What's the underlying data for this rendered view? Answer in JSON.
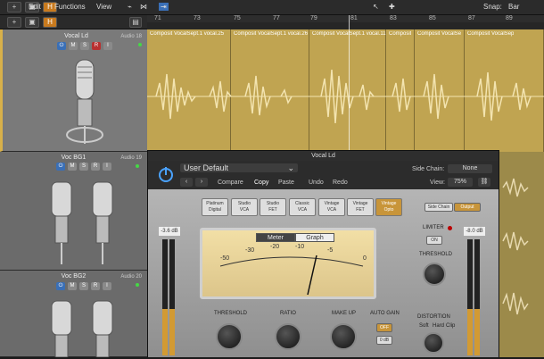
{
  "menubar": {
    "edit": "Edit",
    "functions": "Functions",
    "view": "View",
    "snap_label": "Snap:",
    "snap_value": "Bar"
  },
  "ruler": {
    "ticks": [
      "71",
      "73",
      "75",
      "77",
      "79",
      "81",
      "83",
      "85",
      "87",
      "89"
    ]
  },
  "tracks": [
    {
      "name": "Vocal Ld",
      "number": "Audio 18"
    },
    {
      "name": "Voc BG1",
      "number": "Audio 19"
    },
    {
      "name": "Voc BG2",
      "number": "Audio 20"
    }
  ],
  "buttons": {
    "mute": "M",
    "solo": "S",
    "input": "I",
    "record": "R"
  },
  "regions": [
    "Composit VocalSept.1 vocal.25",
    "Composit VocalSept.1 vocal.26",
    "Composit VocalSept.1 vocal.11",
    "Composit",
    "Composit VocalSe",
    "Composit VocalSep"
  ],
  "plugin": {
    "title": "Vocal Ld",
    "preset": "User Default",
    "sidechain_label": "Side Chain:",
    "sidechain_value": "None",
    "view_label": "View:",
    "view_value": "75%",
    "compare": "Compare",
    "copy": "Copy",
    "paste": "Paste",
    "undo": "Undo",
    "redo": "Redo",
    "models": [
      [
        "Platinum",
        "Digital"
      ],
      [
        "Studio",
        "VCA"
      ],
      [
        "Studio",
        "FET"
      ],
      [
        "Classic",
        "VCA"
      ],
      [
        "Vintage",
        "VCA"
      ],
      [
        "Vintage",
        "FET"
      ],
      [
        "Vintage",
        "Opto"
      ]
    ],
    "meter_tab": "Meter",
    "graph_tab": "Graph",
    "scale": [
      "-50",
      "-30",
      "-20",
      "-10",
      "-5",
      "0"
    ],
    "in_level": "-3.6 dB",
    "out_level": "-8.0 dB",
    "threshold": "THRESHOLD",
    "ratio": "RATIO",
    "makeup": "MAKE UP",
    "autogain": "AUTO GAIN",
    "limiter": "LIMITER",
    "threshold2": "THRESHOLD",
    "distortion": "DISTORTION",
    "sidechain_btn": "Side Chain",
    "output_btn": "Output",
    "off_btn": "OFF",
    "odb_btn": "0 dB",
    "dist_soft": "Soft",
    "dist_hard": "Hard",
    "dist_clip": "Clip"
  }
}
